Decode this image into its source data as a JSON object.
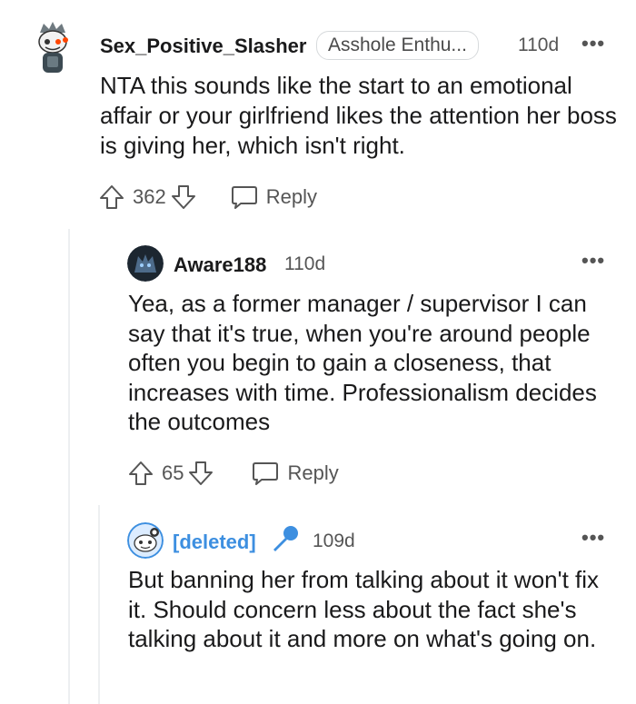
{
  "comments": [
    {
      "username": "Sex_Positive_Slasher",
      "flair": "Asshole Enthu...",
      "age": "110d",
      "text": "NTA this sounds like the start to an emotional affair or your girlfriend likes the attention her boss is giving her, which isn't right.",
      "score": "362",
      "reply_label": "Reply",
      "more_label": "•••"
    },
    {
      "username": "Aware188",
      "age": "110d",
      "text": "Yea, as a former manager / supervisor I can say that it's true, when you're around people often you begin to gain a closeness, that increases with time. Professionalism decides the outcomes",
      "score": "65",
      "reply_label": "Reply",
      "more_label": "•••"
    },
    {
      "username": "[deleted]",
      "age": "109d",
      "text": "But banning her from talking about it won't fix it. Should concern less about the fact she's talking about it and more on what's going on.",
      "more_label": "•••"
    }
  ],
  "colors": {
    "deleted_blue": "#3d8fe0",
    "meta_gray": "#555555",
    "thread_line": "#edeff1"
  },
  "icons": [
    "snoo-avatar-icon",
    "wolf-avatar-icon",
    "deleted-snoo-avatar-icon",
    "microphone-icon",
    "upvote-icon",
    "downvote-icon",
    "reply-bubble-icon",
    "more-options-icon"
  ]
}
